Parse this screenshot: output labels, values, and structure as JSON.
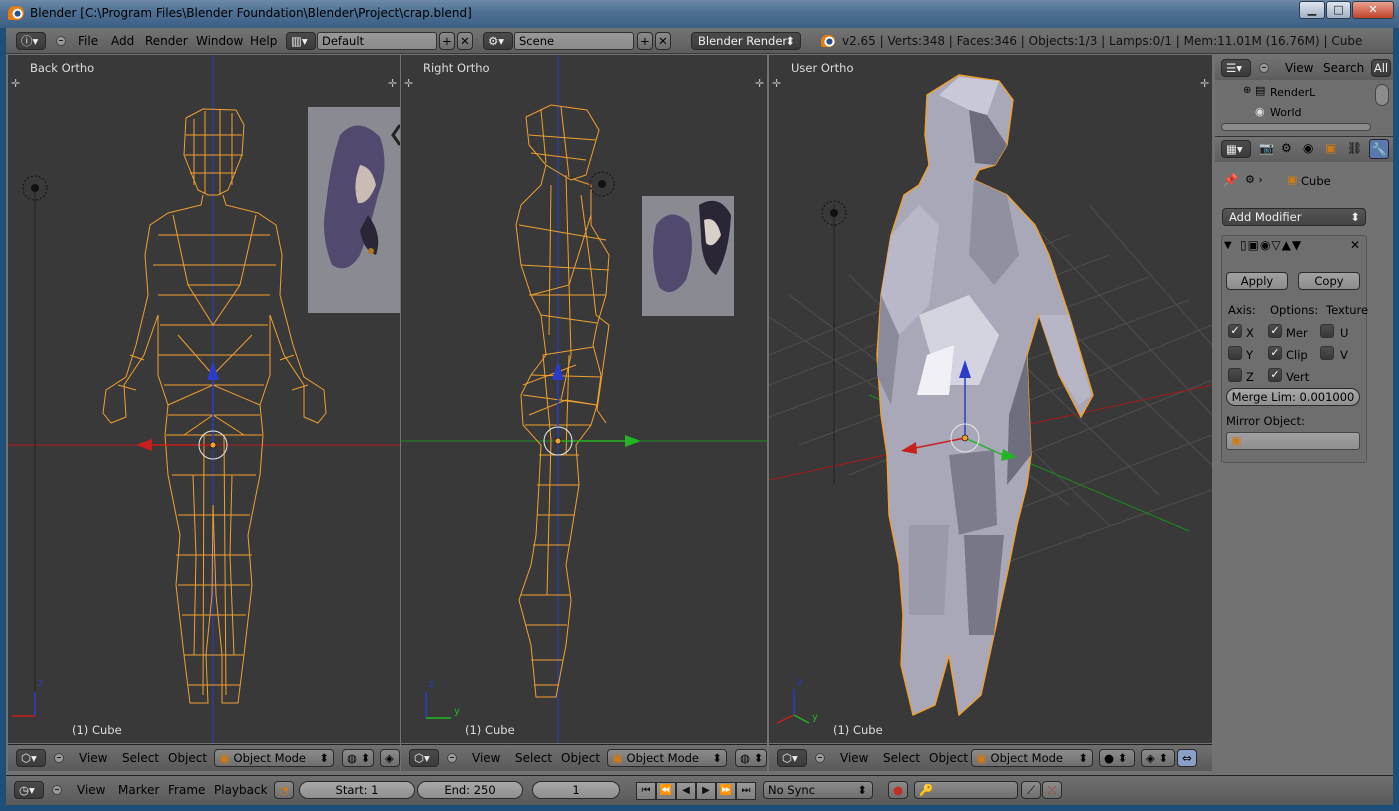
{
  "window": {
    "title": "Blender [C:\\Program Files\\Blender Foundation\\Blender\\Project\\crap.blend]",
    "minimize": "▁",
    "maximize": "□",
    "close": "✕"
  },
  "info_header": {
    "menus": [
      "File",
      "Add",
      "Render",
      "Window",
      "Help"
    ],
    "screen_layout": "Default",
    "scene": "Scene",
    "render_engine": "Blender Render",
    "stats": "v2.65 | Verts:348 | Faces:346 | Objects:1/3 | Lamps:0/1 | Mem:11.01M (16.76M) | Cube"
  },
  "viewports": [
    {
      "name": "Back Ortho",
      "object": "(1) Cube",
      "axis_a": "z",
      "axis_b": ""
    },
    {
      "name": "Right Ortho",
      "object": "(1) Cube",
      "axis_a": "z",
      "axis_b": "y"
    },
    {
      "name": "User Ortho",
      "object": "(1) Cube",
      "axis_a": "z",
      "axis_b": "y"
    }
  ],
  "viewport_header": {
    "menus": [
      "View",
      "Select",
      "Object"
    ],
    "mode": "Object Mode"
  },
  "outliner": {
    "menus": [
      "View",
      "Search"
    ],
    "filter": "All",
    "items": [
      "RenderL",
      "World"
    ]
  },
  "properties": {
    "object_name": "Cube",
    "add_modifier": "Add Modifier",
    "apply": "Apply",
    "copy": "Copy",
    "axis_label": "Axis:",
    "options_label": "Options:",
    "texture_label": "Texture",
    "axes": [
      {
        "axis": "X",
        "checked": true,
        "option": "Mer",
        "option_checked": true,
        "tex": "U",
        "tex_checked": false
      },
      {
        "axis": "Y",
        "checked": false,
        "option": "Clip",
        "option_checked": true,
        "tex": "V",
        "tex_checked": false
      },
      {
        "axis": "Z",
        "checked": false,
        "option": "Vert",
        "option_checked": true,
        "tex": "",
        "tex_checked": false
      }
    ],
    "merge_limit": "Merge Lim: 0.001000",
    "mirror_object_label": "Mirror Object:"
  },
  "timeline": {
    "menus": [
      "View",
      "Marker",
      "Frame",
      "Playback"
    ],
    "start": "Start: 1",
    "end": "End: 250",
    "current_frame": "1",
    "sync": "No Sync"
  },
  "colors": {
    "wire": "#f0a030",
    "viewport_bg": "#393939",
    "header_bg": "#686868",
    "axis_x": "#c81e1e",
    "axis_y": "#22b422",
    "axis_z": "#1c3cd0"
  }
}
